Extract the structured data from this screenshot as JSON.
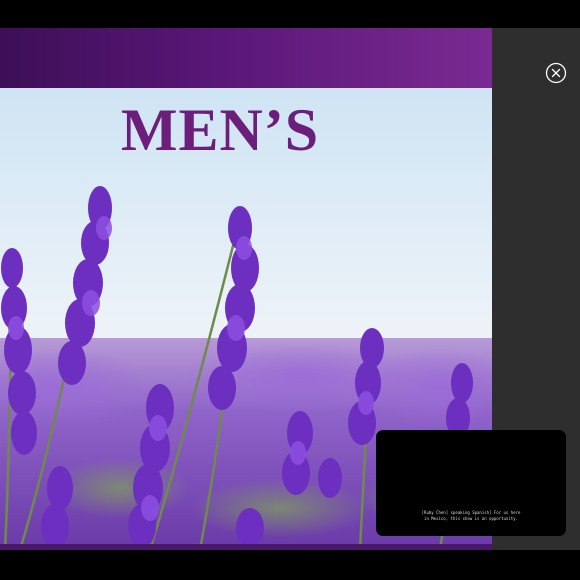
{
  "slide": {
    "title": "MEN’S"
  },
  "caption": {
    "text": "[Ruby Chen] speaking Spanish] For us here\nin Mexico, this show is an opportunity."
  },
  "controls": {
    "close_icon": "close-circle-icon"
  },
  "colors": {
    "header_gradient_start": "#3d0f58",
    "header_gradient_end": "#7a2a92",
    "title": "#6b1f7a",
    "side_panel": "#2e2e2e",
    "lavender": "#7b3fc4"
  }
}
